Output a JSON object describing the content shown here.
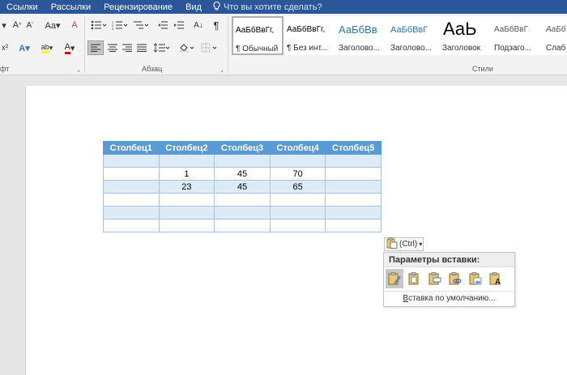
{
  "menu": {
    "items": [
      "Ссылки",
      "Рассылки",
      "Рецензирование",
      "Вид"
    ],
    "tellme": "Что вы хотите сделать?"
  },
  "ribbon": {
    "groups": {
      "font_partial": "фт",
      "paragraph": "Абзац",
      "styles": "Стили"
    },
    "styles": [
      {
        "sample": "АаБбВвГг,",
        "name": "¶ Обычный"
      },
      {
        "sample": "АаБбВвГг,",
        "name": "¶ Без инт..."
      },
      {
        "sample": "АаБбВв",
        "name": "Заголово..."
      },
      {
        "sample": "АаБбВвГ",
        "name": "Заголово..."
      },
      {
        "sample": "АаЬ",
        "name": "Заголовок"
      },
      {
        "sample": "АаБбВвГ",
        "name": "Подзаго..."
      },
      {
        "sample": "АаБбВвГ",
        "name": "Слабое ..."
      }
    ]
  },
  "table": {
    "headers": [
      "Столбец1",
      "Столбец2",
      "Столбец3",
      "Столбец4",
      "Столбец5"
    ],
    "rows": [
      [
        "",
        "",
        "",
        "",
        ""
      ],
      [
        "",
        "1",
        "45",
        "70",
        ""
      ],
      [
        "",
        "23",
        "45",
        "65",
        ""
      ],
      [
        "",
        "",
        "",
        "",
        ""
      ],
      [
        "",
        "",
        "",
        "",
        ""
      ],
      [
        "",
        "",
        "",
        "",
        ""
      ]
    ]
  },
  "paste": {
    "button_label": "(Ctrl)",
    "menu_title": "Параметры вставки:",
    "default_prefix": "В",
    "default_rest": "ставка по умолчанию..."
  },
  "colors": {
    "title_bar": "#2b579a",
    "table_header": "#5b9bd5",
    "table_band": "#ddebf7"
  }
}
